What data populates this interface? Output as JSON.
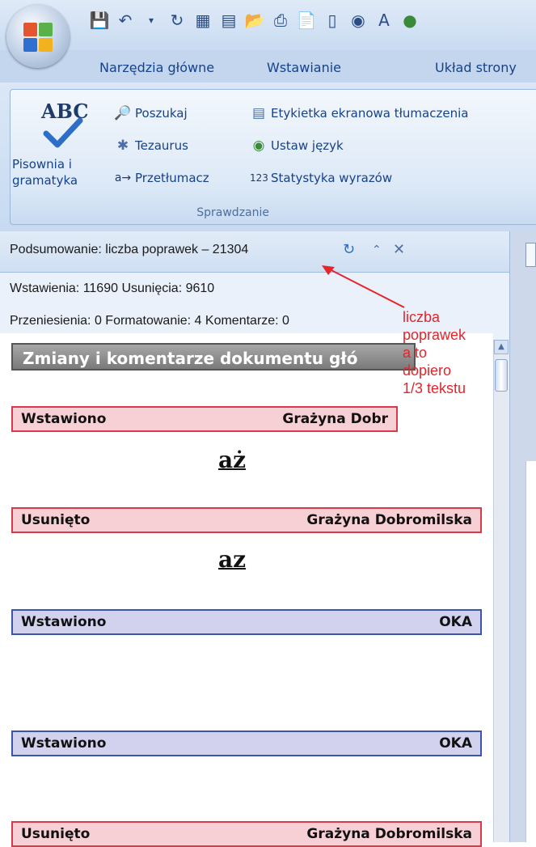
{
  "ribbon": {
    "tabs": [
      "Narzędzia główne",
      "Wstawianie",
      "Układ strony"
    ],
    "group_label": "Sprawdzanie",
    "spelling_icon_text": "ABC",
    "spelling_label_line1": "Pisownia i",
    "spelling_label_line2": "gramatyka",
    "items": {
      "research": "Poszukaj",
      "thesaurus": "Tezaurus",
      "translate": "Przetłumacz",
      "screentip": "Etykietka ekranowa tłumaczenia",
      "set_language": "Ustaw język",
      "word_count": "Statystyka wyrazów"
    }
  },
  "pane": {
    "title": "Podsumowanie: liczba poprawek – 21304",
    "summary_line1": "Wstawienia: 11690  Usunięcia: 9610",
    "summary_line2": "Przeniesienia: 0  Formatowanie: 4  Komentarze: 0",
    "annotation_lines": [
      "liczba",
      "poprawek",
      "a to",
      "dopiero",
      "1/3 tekstu"
    ],
    "doc_header": "Zmiany i komentarze dokumentu głó",
    "changes": [
      {
        "type": "Wstawiono",
        "author": "Grażyna Dobr",
        "text": "aż"
      },
      {
        "type": "Usunięto",
        "author": "Grażyna Dobromilska",
        "text": "az"
      },
      {
        "type": "Wstawiono",
        "author": "OKA",
        "text": ""
      },
      {
        "type": "Wstawiono",
        "author": "OKA",
        "text": ""
      },
      {
        "type": "Usunięto",
        "author": "Grażyna Dobromilska",
        "text": ""
      }
    ]
  },
  "colors": {
    "annotation": "#e5242c",
    "deletion_border": "#d93a49",
    "insertion_border": "#3a56a8"
  }
}
